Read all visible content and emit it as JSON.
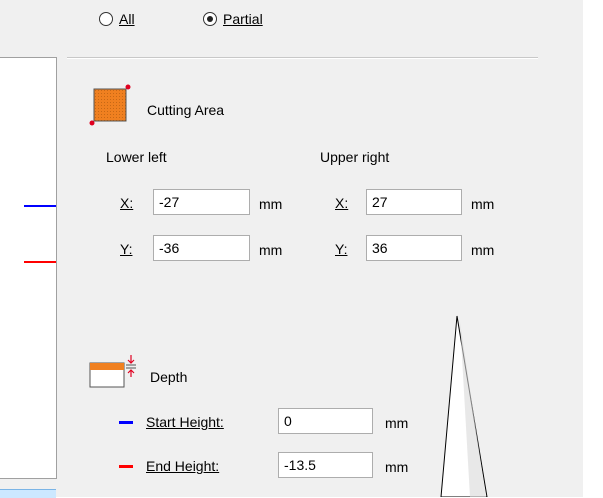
{
  "scope": {
    "all_label": "All",
    "partial_label": "Partial",
    "selected": "Partial"
  },
  "cutting_area": {
    "title": "Cutting Area",
    "lower_left_label": "Lower left",
    "upper_right_label": "Upper right",
    "lower_left": {
      "x_label": "X:",
      "x_value": "-27",
      "y_label": "Y:",
      "y_value": "-36"
    },
    "upper_right": {
      "x_label": "X:",
      "x_value": "27",
      "y_label": "Y:",
      "y_value": "36"
    },
    "unit": "mm"
  },
  "depth": {
    "title": "Depth",
    "start_height_label": "Start Height:",
    "start_height_value": "0",
    "end_height_label": "End Height:",
    "end_height_value": "-13.5",
    "unit": "mm"
  },
  "colors": {
    "start_line": "#0000ff",
    "end_line": "#ff0000",
    "area_icon": "#f08020"
  }
}
